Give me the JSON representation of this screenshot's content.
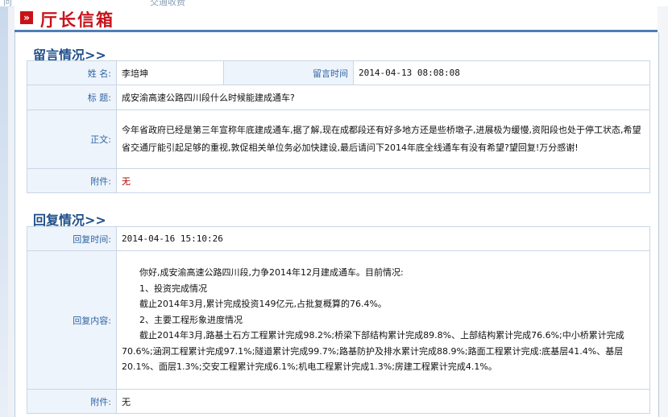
{
  "topstrip": {
    "left_text": "问",
    "center_text": "交通收费"
  },
  "header": {
    "title": "厅长信箱"
  },
  "message": {
    "section_title": "留言情况>>",
    "name_label": "姓  名:",
    "name": "李培坤",
    "time_label": "留言时间",
    "time": "2014-04-13 08:08:08",
    "subject_label": "标  题:",
    "subject": "成安渝高速公路四川段什么时候能建成通车?",
    "body_label": "正文:",
    "body": "今年省政府已经是第三年宣称年底建成通车,据了解,现在成都段还有好多地方还是些桥墩子,进展极为缓慢,资阳段也处于停工状态,希望省交通厅能引起足够的重视,敦促相关单位务必加快建设,最后请问下2014年底全线通车有没有希望?望回复!万分感谢!",
    "attachment_label": "附件:",
    "attachment": "无"
  },
  "reply": {
    "section_title": "回复情况>>",
    "time_label": "回复时间:",
    "time": "2014-04-16 15:10:26",
    "content_label": "回复内容:",
    "lines": [
      "你好,成安渝高速公路四川段,力争2014年12月建成通车。目前情况:",
      "1、投资完成情况",
      "截止2014年3月,累计完成投资149亿元,占批复概算的76.4%。",
      "2、主要工程形象进度情况",
      "截止2014年3月,路基土石方工程累计完成98.2%;桥梁下部结构累计完成89.8%、上部结构累计完成76.6%;中小桥累计完成70.6%;涵洞工程累计完成97.1%;隧道累计完成99.7%;路基防护及排水累计完成88.9%;路面工程累计完成:底基层41.4%、基层20.1%、面层1.3%;交安工程累计完成6.1%;机电工程累计完成1.3%;房建工程累计完成4.1%。"
    ],
    "attachment_label": "附件:",
    "attachment": "无"
  }
}
